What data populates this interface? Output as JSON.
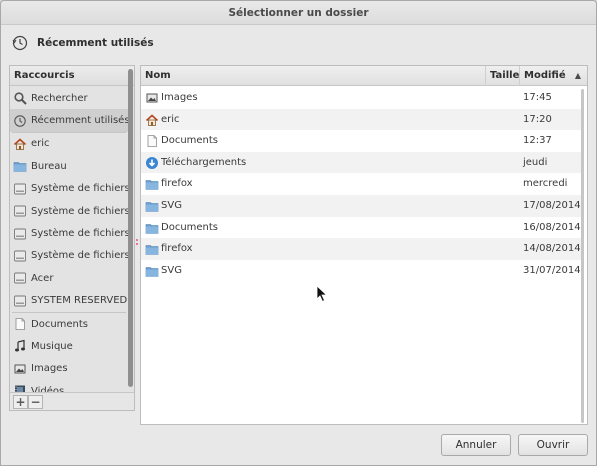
{
  "window": {
    "title": "Sélectionner un dossier"
  },
  "location": {
    "icon": "clock-icon",
    "label": "Récemment utilisés"
  },
  "sidebar": {
    "header": "Raccourcis",
    "groups": [
      [
        {
          "label": "Rechercher",
          "icon": "search-icon"
        },
        {
          "label": "Récemment utilisés",
          "icon": "clock-icon",
          "selected": true
        }
      ],
      [
        {
          "label": "eric",
          "icon": "home-icon"
        },
        {
          "label": "Bureau",
          "icon": "folder-icon"
        },
        {
          "label": "Système de fichiers",
          "icon": "drive-icon"
        },
        {
          "label": "Système de fichiers ...",
          "icon": "drive-icon"
        },
        {
          "label": "Système de fichiers ...",
          "icon": "drive-icon"
        },
        {
          "label": "Système de fichiers ...",
          "icon": "drive-icon"
        },
        {
          "label": "Acer",
          "icon": "drive-icon"
        },
        {
          "label": "SYSTEM RESERVED",
          "icon": "drive-icon"
        }
      ],
      [
        {
          "label": "Documents",
          "icon": "document-icon"
        },
        {
          "label": "Musique",
          "icon": "music-icon"
        },
        {
          "label": "Images",
          "icon": "images-icon"
        },
        {
          "label": "Vidéos",
          "icon": "video-icon"
        }
      ]
    ],
    "add_label": "+",
    "remove_label": "−"
  },
  "filelist": {
    "columns": {
      "name": "Nom",
      "size": "Taille",
      "modified": "Modifié"
    },
    "sort_indicator": "▲",
    "rows": [
      {
        "name": "Images",
        "modified": "17:45",
        "icon": "images-icon"
      },
      {
        "name": "eric",
        "modified": "17:20",
        "icon": "home-icon"
      },
      {
        "name": "Documents",
        "modified": "12:37",
        "icon": "document-icon"
      },
      {
        "name": "Téléchargements",
        "modified": "jeudi",
        "icon": "download-icon"
      },
      {
        "name": "firefox",
        "modified": "mercredi",
        "icon": "folder-icon"
      },
      {
        "name": "SVG",
        "modified": "17/08/2014",
        "icon": "folder-icon"
      },
      {
        "name": "Documents",
        "modified": "16/08/2014",
        "icon": "folder-icon"
      },
      {
        "name": "firefox",
        "modified": "14/08/2014",
        "icon": "folder-icon"
      },
      {
        "name": "SVG",
        "modified": "31/07/2014",
        "icon": "folder-icon"
      }
    ]
  },
  "buttons": {
    "cancel": "Annuler",
    "open": "Ouvrir"
  }
}
